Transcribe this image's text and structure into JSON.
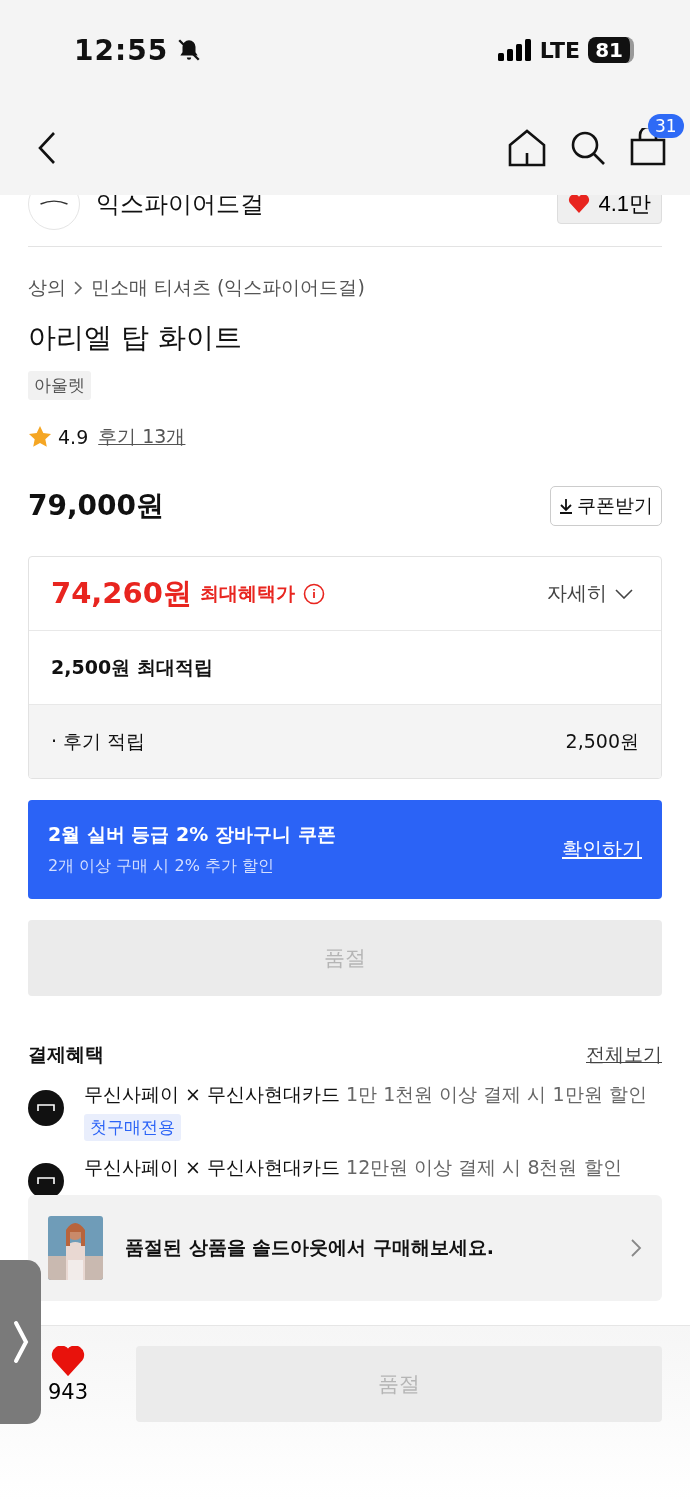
{
  "status_bar": {
    "time": "12:55",
    "network": "LTE",
    "battery": "81"
  },
  "nav": {
    "cart_badge": "31"
  },
  "store": {
    "name": "익스파이어드걸",
    "likes": "4.1만"
  },
  "breadcrumb": [
    "상의",
    "민소매 티셔츠 (익스파이어드걸)"
  ],
  "product": {
    "title": "아리엘 탑 화이트",
    "tag": "아울렛",
    "rating": "4.9",
    "reviews": "후기 13개",
    "price": "79,000원",
    "coupon_button": "쿠폰받기"
  },
  "benefit": {
    "max_price": "74,260원",
    "max_label": "최대혜택가",
    "detail": "자세히",
    "points": "2,500원 최대적립",
    "review_label": "· 후기 적립",
    "review_value": "2,500원"
  },
  "promo": {
    "title": "2월 실버 등급 2% 장바구니 쿠폰",
    "subtitle": "2개 이상 구매 시 2% 추가 할인",
    "link": "확인하기"
  },
  "soldout_button": {
    "label": "품절",
    "disabled": true
  },
  "payment": {
    "title": "결제혜택",
    "link": "전체보기",
    "items": [
      {
        "card": "무신사페이 × 무신사현대카드",
        "desc": "1만 1천원 이상 결제 시 1만원 할인",
        "tag": "첫구매전용"
      },
      {
        "card": "무신사페이 × 무신사현대카드",
        "desc": "12만원 이상 결제 시 8천원 할인"
      }
    ]
  },
  "soldout_banner": {
    "text": "품절된 상품을 솔드아웃에서 구매해보세요."
  },
  "bottom_bar": {
    "liked": true,
    "likes": "943",
    "buy_button": {
      "label": "품절",
      "disabled": true
    }
  }
}
